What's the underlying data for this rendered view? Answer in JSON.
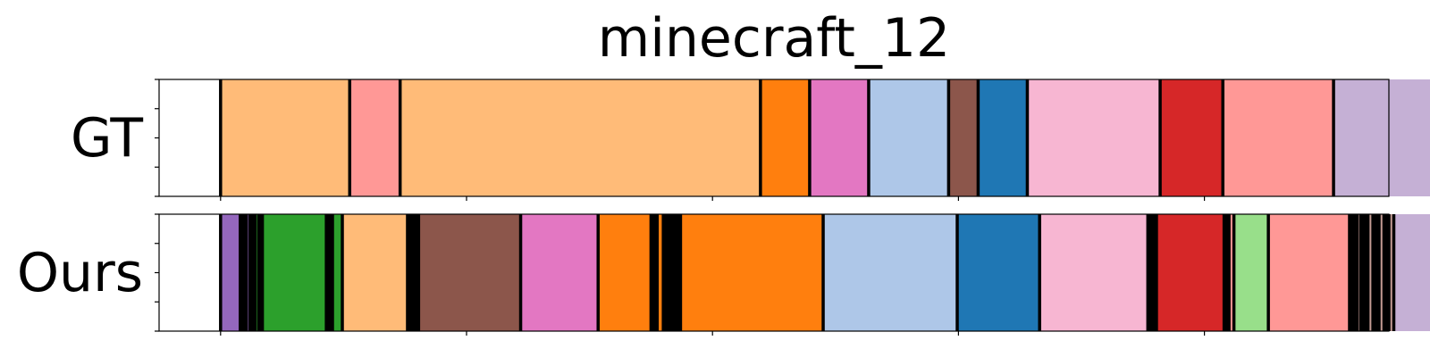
{
  "chart_data": {
    "type": "segmentation-timeline",
    "title": "minecraft_12",
    "x_range": [
      0,
      1000
    ],
    "rows": [
      {
        "label": "GT",
        "segments": [
          {
            "start": 50,
            "end": 155,
            "color": "#ffbb78"
          },
          {
            "start": 155,
            "end": 196,
            "color": "#ff9896"
          },
          {
            "start": 196,
            "end": 489,
            "color": "#ffbb78"
          },
          {
            "start": 489,
            "end": 529,
            "color": "#ff7f0e"
          },
          {
            "start": 529,
            "end": 577,
            "color": "#e377c2"
          },
          {
            "start": 577,
            "end": 642,
            "color": "#aec7e8"
          },
          {
            "start": 642,
            "end": 666,
            "color": "#8c564b"
          },
          {
            "start": 666,
            "end": 706,
            "color": "#1f77b4"
          },
          {
            "start": 706,
            "end": 814,
            "color": "#f7b6d2"
          },
          {
            "start": 814,
            "end": 865,
            "color": "#d62728"
          },
          {
            "start": 865,
            "end": 955,
            "color": "#ff9896"
          },
          {
            "start": 955,
            "end": 1045,
            "color": "#c5b0d5"
          }
        ]
      },
      {
        "label": "Ours",
        "segments": [
          {
            "start": 50,
            "end": 66,
            "color": "#9467bd"
          },
          {
            "start": 66,
            "end": 71,
            "color": "#000000"
          },
          {
            "start": 71,
            "end": 74,
            "color": "#9467bd"
          },
          {
            "start": 74,
            "end": 78,
            "color": "#000000"
          },
          {
            "start": 78,
            "end": 81,
            "color": "#2ca02c"
          },
          {
            "start": 81,
            "end": 84,
            "color": "#000000"
          },
          {
            "start": 84,
            "end": 136,
            "color": "#2ca02c"
          },
          {
            "start": 136,
            "end": 141,
            "color": "#000000"
          },
          {
            "start": 141,
            "end": 149,
            "color": "#2ca02c"
          },
          {
            "start": 149,
            "end": 202,
            "color": "#ffbb78"
          },
          {
            "start": 202,
            "end": 211,
            "color": "#000000"
          },
          {
            "start": 211,
            "end": 294,
            "color": "#8c564b"
          },
          {
            "start": 294,
            "end": 357,
            "color": "#e377c2"
          },
          {
            "start": 357,
            "end": 400,
            "color": "#ff7f0e"
          },
          {
            "start": 400,
            "end": 405,
            "color": "#000000"
          },
          {
            "start": 405,
            "end": 410,
            "color": "#ff7f0e"
          },
          {
            "start": 410,
            "end": 424,
            "color": "#000000"
          },
          {
            "start": 424,
            "end": 540,
            "color": "#ff7f0e"
          },
          {
            "start": 540,
            "end": 649,
            "color": "#aec7e8"
          },
          {
            "start": 649,
            "end": 716,
            "color": "#1f77b4"
          },
          {
            "start": 716,
            "end": 804,
            "color": "#f7b6d2"
          },
          {
            "start": 804,
            "end": 811,
            "color": "#000000"
          },
          {
            "start": 811,
            "end": 866,
            "color": "#d62728"
          },
          {
            "start": 866,
            "end": 870,
            "color": "#000000"
          },
          {
            "start": 870,
            "end": 874,
            "color": "#ff9896"
          },
          {
            "start": 874,
            "end": 902,
            "color": "#98df8a"
          },
          {
            "start": 902,
            "end": 968,
            "color": "#ff9896"
          },
          {
            "start": 968,
            "end": 974,
            "color": "#000000"
          },
          {
            "start": 974,
            "end": 977,
            "color": "#c49c94"
          },
          {
            "start": 977,
            "end": 983,
            "color": "#000000"
          },
          {
            "start": 983,
            "end": 987,
            "color": "#c49c94"
          },
          {
            "start": 987,
            "end": 992,
            "color": "#000000"
          },
          {
            "start": 992,
            "end": 996,
            "color": "#c49c94"
          },
          {
            "start": 996,
            "end": 1000,
            "color": "#000000"
          },
          {
            "start": 1000,
            "end": 1004,
            "color": "#c49c94"
          },
          {
            "start": 1004,
            "end": 1045,
            "color": "#c5b0d5"
          }
        ]
      }
    ],
    "x_ticks": [
      50,
      250,
      450,
      650,
      850,
      1050
    ],
    "y_ticks": 5,
    "tick_labels_visible": false,
    "grid": false,
    "legend": "none"
  }
}
